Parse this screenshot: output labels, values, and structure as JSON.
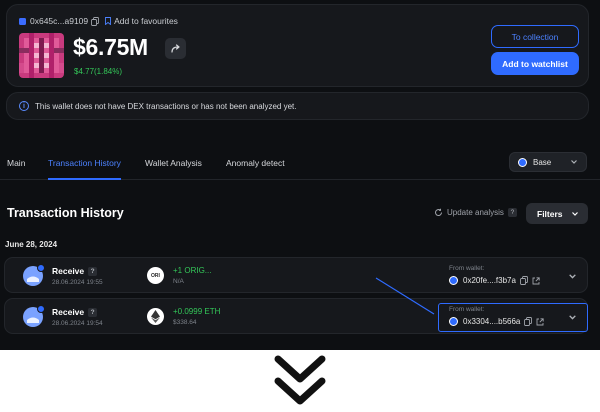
{
  "header": {
    "wallet_short": "0x645c...a9109",
    "favourite_label": "Add to favourites",
    "balance": "$6.75M",
    "change": "$4.77(1.84%)",
    "to_collection": "To collection",
    "add_watchlist": "Add to watchlist"
  },
  "notice": "This wallet does not have DEX transactions or has not been analyzed yet.",
  "tabs": [
    {
      "label": "Main"
    },
    {
      "label": "Transaction History"
    },
    {
      "label": "Wallet Analysis"
    },
    {
      "label": "Anomaly detect"
    }
  ],
  "chain": "Base",
  "history": {
    "title": "Transaction History",
    "update": "Update analysis",
    "filters": "Filters",
    "date": "June 28, 2024",
    "rows": [
      {
        "type": "Receive",
        "time": "28.06.2024 19:55",
        "token_icon": "ORI",
        "amount": "+1 ORIG...",
        "usd": "N/A",
        "from_label": "From wallet:",
        "from": "0x20fe....f3b7a"
      },
      {
        "type": "Receive",
        "time": "28.06.2024 19:54",
        "token_icon": "eth-icon",
        "amount": "+0.0999 ETH",
        "usd": "$338.64",
        "from_label": "From wallet:",
        "from": "0x3304....b566a"
      }
    ]
  },
  "colors": {
    "accent": "#2f6bff",
    "positive": "#34c759",
    "background": "#0d0f12"
  }
}
